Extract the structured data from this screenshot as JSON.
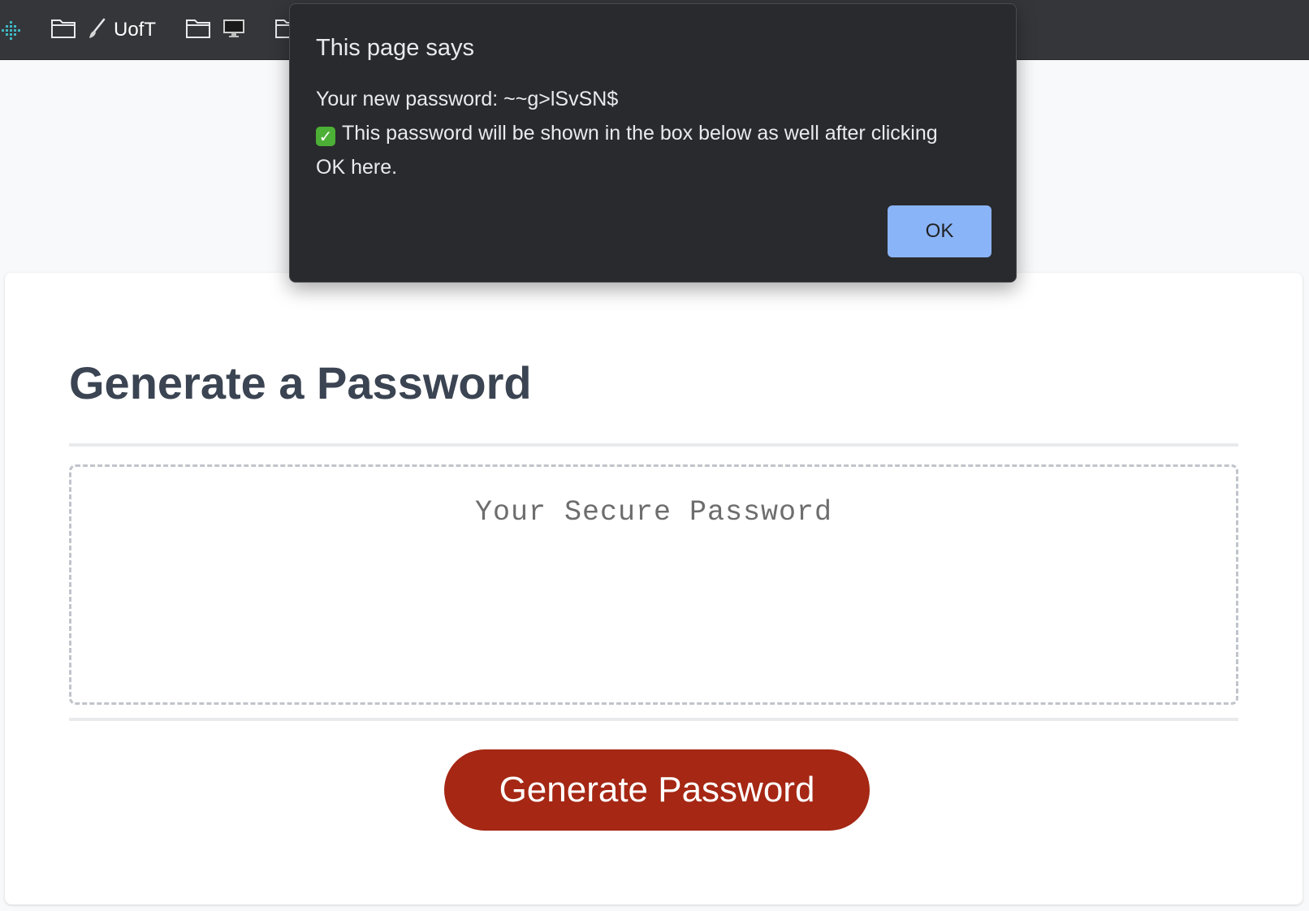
{
  "bookmarks_bar": {
    "items": [
      {
        "icon": "app-grid-icon",
        "label": ""
      },
      {
        "icon": "folder-icon",
        "label": ""
      },
      {
        "icon": "brush-icon",
        "label": "UofT"
      },
      {
        "icon": "folder-icon",
        "label": ""
      },
      {
        "icon": "monitor-icon",
        "label": ""
      },
      {
        "icon": "folder-icon",
        "label": ""
      }
    ]
  },
  "dialog": {
    "title": "This page says",
    "line1": "Your new password: ~~g>lSvSN$",
    "check_icon": "check-mark-emoji",
    "line2": "This password will be shown in the box below as well after clicking OK here.",
    "ok_label": "OK"
  },
  "card": {
    "title": "Generate a Password",
    "password_placeholder": "Your Secure Password",
    "password_value": "",
    "generate_label": "Generate Password"
  },
  "colors": {
    "bookmarks_bar_bg": "#35363a",
    "dialog_bg": "#292a2d",
    "ok_button": "#8ab4f8",
    "generate_button": "#a52714",
    "title_text": "#3b4452"
  }
}
